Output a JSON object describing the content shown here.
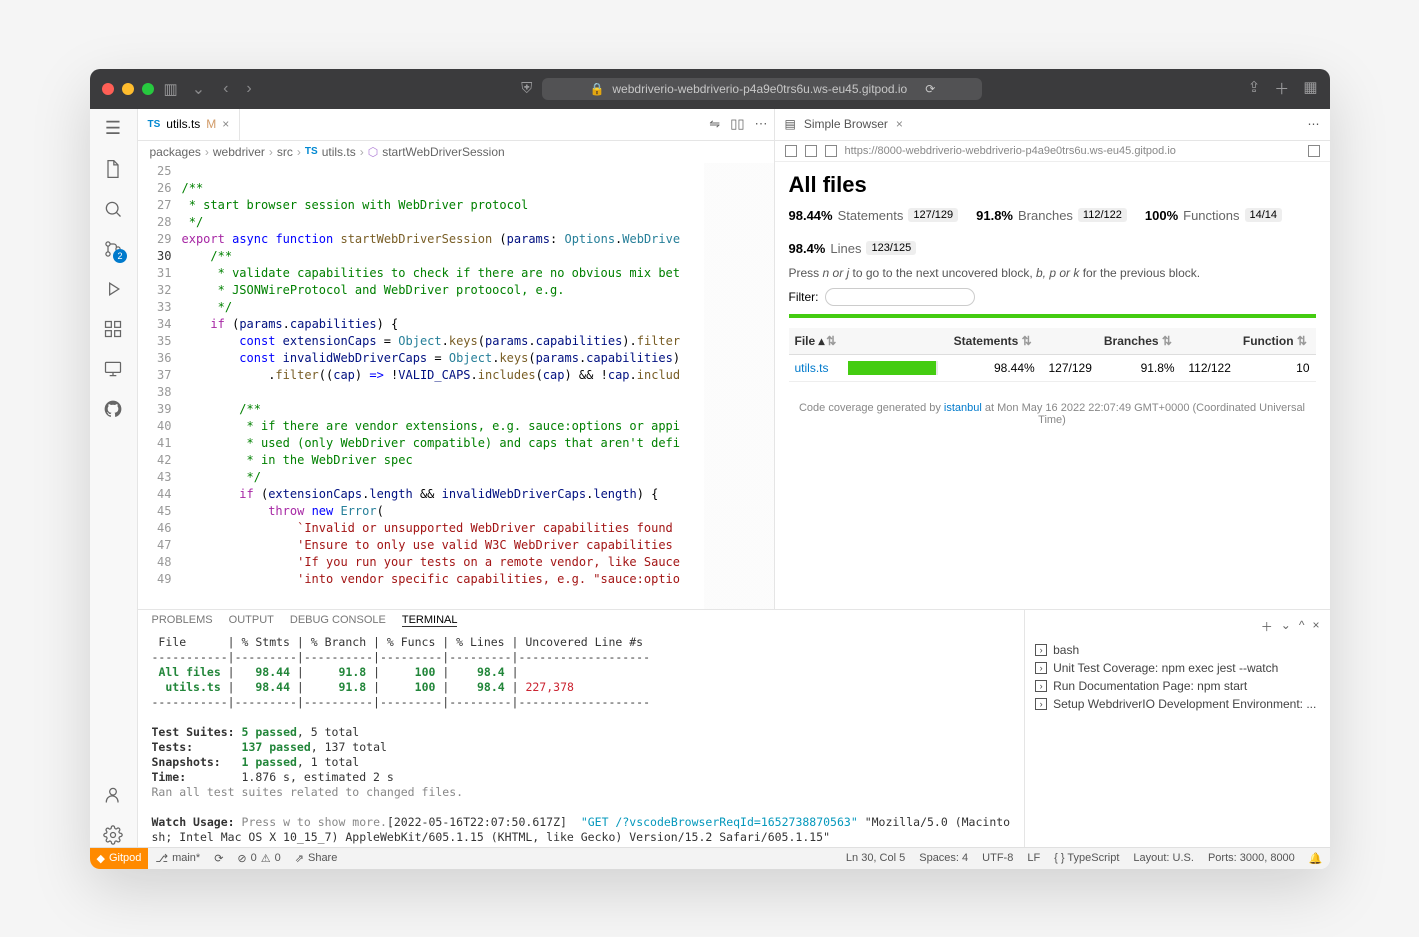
{
  "safari": {
    "url": "webdriverio-webdriverio-p4a9e0trs6u.ws-eu45.gitpod.io"
  },
  "tab": {
    "icon": "TS",
    "name": "utils.ts",
    "modified": "M"
  },
  "breadcrumbs": [
    "packages",
    "webdriver",
    "src",
    "utils.ts",
    "startWebDriverSession"
  ],
  "activity_badge": "2",
  "line_start": 25,
  "current_line": 30,
  "code_lines": [
    "",
    "<span class='com'>/**</span>",
    "<span class='com'> * start browser session with WebDriver protocol</span>",
    "<span class='com'> */</span>",
    "<span class='kw'>export</span> <span class='kw2'>async function</span> <span class='fn'>startWebDriverSession</span> (<span class='prop'>params</span>: <span class='typ'>Options</span>.<span class='typ'>WebDrive</span>",
    "    <span class='com'>/**</span>",
    "    <span class='com'> * validate capabilities to check if there are no obvious mix bet</span>",
    "    <span class='com'> * JSONWireProtocol and WebDriver protoocol, e.g.</span>",
    "    <span class='com'> */</span>",
    "    <span class='kw'>if</span> (<span class='prop'>params</span>.<span class='prop'>capabilities</span>) {",
    "        <span class='kw2'>const</span> <span class='prop'>extensionCaps</span> = <span class='typ'>Object</span>.<span class='fn'>keys</span>(<span class='prop'>params</span>.<span class='prop'>capabilities</span>).<span class='fn'>filter</span>",
    "        <span class='kw2'>const</span> <span class='prop'>invalidWebDriverCaps</span> = <span class='typ'>Object</span>.<span class='fn'>keys</span>(<span class='prop'>params</span>.<span class='prop'>capabilities</span>)",
    "            .<span class='fn'>filter</span>((<span class='prop'>cap</span>) <span class='kw2'>=&gt;</span> !<span class='prop'>VALID_CAPS</span>.<span class='fn'>includes</span>(<span class='prop'>cap</span>) &amp;&amp; !<span class='prop'>cap</span>.<span class='fn'>includ</span>",
    "",
    "        <span class='com'>/**</span>",
    "        <span class='com'> * if there are vendor extensions, e.g. sauce:options or appi</span>",
    "        <span class='com'> * used (only WebDriver compatible) and caps that aren't defi</span>",
    "        <span class='com'> * in the WebDriver spec</span>",
    "        <span class='com'> */</span>",
    "        <span class='kw'>if</span> (<span class='prop'>extensionCaps</span>.<span class='prop'>length</span> &amp;&amp; <span class='prop'>invalidWebDriverCaps</span>.<span class='prop'>length</span>) {",
    "            <span class='kw'>throw</span> <span class='kw2'>new</span> <span class='typ'>Error</span>(",
    "                <span class='str'>`Invalid or unsupported WebDriver capabilities found</span>",
    "                <span class='str'>'Ensure to only use valid W3C WebDriver capabilities</span>",
    "                <span class='str'>'If you run your tests on a remote vendor, like Sauce</span>",
    "                <span class='str'>'into vendor specific capabilities, e.g. \"sauce:optio</span>"
  ],
  "simple_browser_label": "Simple Browser",
  "sb_url": "https://8000-webdriverio-webdriverio-p4a9e0trs6u.ws-eu45.gitpod.io",
  "coverage": {
    "title": "All files",
    "stats": [
      {
        "pct": "98.44%",
        "label": "Statements",
        "frac": "127/129"
      },
      {
        "pct": "91.8%",
        "label": "Branches",
        "frac": "112/122"
      },
      {
        "pct": "100%",
        "label": "Functions",
        "frac": "14/14"
      },
      {
        "pct": "98.4%",
        "label": "Lines",
        "frac": "123/125"
      }
    ],
    "help_pre": "Press ",
    "help_nj": "n or j",
    "help_mid": " to go to the next uncovered block, ",
    "help_bpk": "b, p or k",
    "help_post": " for the previous block.",
    "filter_label": "Filter:",
    "cols": [
      "File",
      "",
      "Statements",
      "",
      "Branches",
      "",
      "Function"
    ],
    "row": {
      "file": "utils.ts",
      "bar": 98.44,
      "stmt_pct": "98.44%",
      "stmt_frac": "127/129",
      "br_pct": "91.8%",
      "br_frac": "112/122",
      "fn_pct": "10"
    },
    "footer_pre": "Code coverage generated by ",
    "footer_link": "istanbul",
    "footer_post": " at Mon May 16 2022 22:07:49 GMT+0000 (Coordinated Universal Time)"
  },
  "panel_tabs": [
    "PROBLEMS",
    "OUTPUT",
    "DEBUG CONSOLE",
    "TERMINAL"
  ],
  "terminal_text": " File      | % Stmts | % Branch | % Funcs | % Lines | Uncovered Line #s\n-----------|---------|----------|---------|---------|-------------------\n <span class='g'>All files</span> |   <span class='g'>98.44</span> |     <span class='g'>91.8</span> |     <span class='g'>100</span> |    <span class='g'>98.4</span> |\n  <span class='g'>utils.ts</span> |   <span class='g'>98.44</span> |     <span class='g'>91.8</span> |     <span class='g'>100</span> |    <span class='g'>98.4</span> | <span class='r'>227,378</span>\n-----------|---------|----------|---------|---------|-------------------\n\n<span class='b'>Test Suites:</span> <span class='g'>5 passed</span>, 5 total\n<span class='b'>Tests:</span>       <span class='g'>137 passed</span>, 137 total\n<span class='b'>Snapshots:</span>   <span class='g'>1 passed</span>, 1 total\n<span class='b'>Time:</span>        1.876 s, estimated 2 s\n<span class='dim'>Ran all test suites related to changed files.</span>\n\n<span class='b'>Watch Usage:</span> <span class='dim'>Press w to show more.</span>[2022-05-16T22:07:50.617Z]  <span class='cy'>\"GET /?vscodeBrowserReqId=1652738870563\"</span> \"Mozilla/5.0 (Macinto\nsh; Intel Mac OS X 10_15_7) AppleWebKit/605.1.15 (KHTML, like Gecko) Version/15.2 Safari/605.1.15\"",
  "terminals": [
    "bash",
    "Unit Test Coverage: npm exec jest --watch",
    "Run Documentation Page: npm start",
    "Setup WebdriverIO Development Environment: ..."
  ],
  "status_left": {
    "gitpod": "Gitpod",
    "branch": "main*",
    "errors": "0",
    "warnings": "0",
    "share": "Share"
  },
  "status_right": [
    "Ln 30, Col 5",
    "Spaces: 4",
    "UTF-8",
    "LF",
    "{ } TypeScript",
    "Layout: U.S.",
    "Ports: 3000, 8000"
  ]
}
